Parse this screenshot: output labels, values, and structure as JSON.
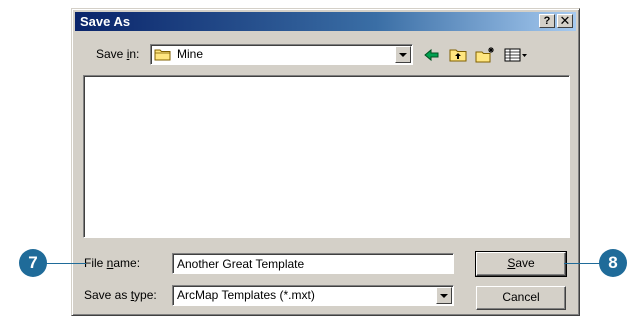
{
  "window": {
    "title": "Save As",
    "help_glyph": "?",
    "close_glyph": "✕"
  },
  "toolbar": {
    "save_in_pre": "Save ",
    "save_in_key": "i",
    "save_in_post": "n:",
    "location": "Mine",
    "icons": [
      "back-icon",
      "up-one-level-icon",
      "create-new-folder-icon",
      "view-menu-icon"
    ]
  },
  "filename": {
    "label_pre": "File ",
    "label_key": "n",
    "label_post": "ame:",
    "value": "Another Great Template"
  },
  "filetype": {
    "label_pre": "Save as ",
    "label_key": "t",
    "label_post": "ype:",
    "value": "ArcMap Templates (*.mxt)"
  },
  "buttons": {
    "save_key": "S",
    "save_rest": "ave",
    "cancel": "Cancel"
  },
  "callouts": {
    "left": "7",
    "right": "8"
  },
  "colors": {
    "callout": "#1f6b99",
    "titlebar": "#0a246a",
    "face": "#d4d0c8"
  }
}
